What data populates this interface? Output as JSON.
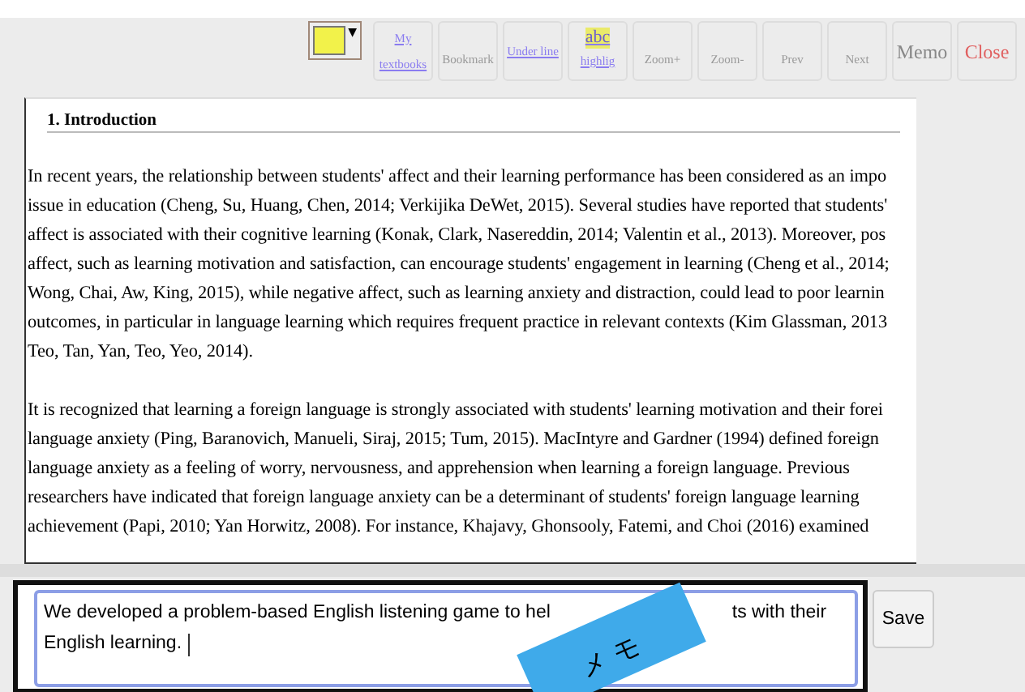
{
  "toolbar": {
    "color_picker": {
      "color": "#f2f24a",
      "caret": "▼"
    },
    "buttons": [
      {
        "kind": "link",
        "label": "My textbooks"
      },
      {
        "kind": "plain",
        "label": "Bookmark"
      },
      {
        "kind": "link",
        "label": "Under line"
      },
      {
        "kind": "highlight",
        "sample": "abc",
        "label": "highlig"
      },
      {
        "kind": "plain",
        "label": "Zoom+"
      },
      {
        "kind": "plain",
        "label": "Zoom-"
      },
      {
        "kind": "plain",
        "label": "Prev"
      },
      {
        "kind": "plain",
        "label": "Next"
      },
      {
        "kind": "large",
        "label": "Memo"
      },
      {
        "kind": "danger",
        "label": "Close"
      }
    ]
  },
  "document": {
    "heading": "1. Introduction",
    "paragraphs": [
      [
        "In recent years, the relationship between students' affect and their learning performance has been considered as an impo",
        "issue in education (Cheng, Su, Huang, Chen, 2014; Verkijika DeWet, 2015). Several studies have reported that students'",
        "affect is associated with their cognitive learning (Konak, Clark, Nasereddin, 2014; Valentin et al., 2013). Moreover, pos",
        "affect, such as learning motivation and satisfaction, can encourage students' engagement in learning (Cheng et al., 2014;",
        "Wong, Chai, Aw, King, 2015), while negative affect, such as learning anxiety and distraction, could lead to poor learnin",
        "outcomes, in particular in language learning which requires frequent practice in relevant contexts (Kim Glassman, 2013",
        "Teo, Tan, Yan, Teo, Yeo, 2014)."
      ],
      [
        "It is recognized that learning a foreign language is strongly associated with students' learning motivation and their forei",
        "language anxiety (Ping, Baranovich, Manueli, Siraj, 2015; Tum, 2015). MacIntyre and Gardner (1994) defined foreign",
        "language anxiety as a feeling of worry, nervousness, and apprehension when learning a foreign language. Previous",
        "researchers have indicated that foreign language anxiety can be a determinant of students' foreign language learning",
        "achievement (Papi, 2010; Yan Horwitz, 2008). For instance, Khajavy, Ghonsooly, Fatemi, and Choi (2016) examined"
      ]
    ]
  },
  "memo": {
    "line_1_start": "We developed a problem-based English listening game to hel",
    "line_1_end": "ts with their",
    "line_2": "English learning.",
    "save_label": "Save"
  },
  "sticker": {
    "label": "メモ"
  }
}
